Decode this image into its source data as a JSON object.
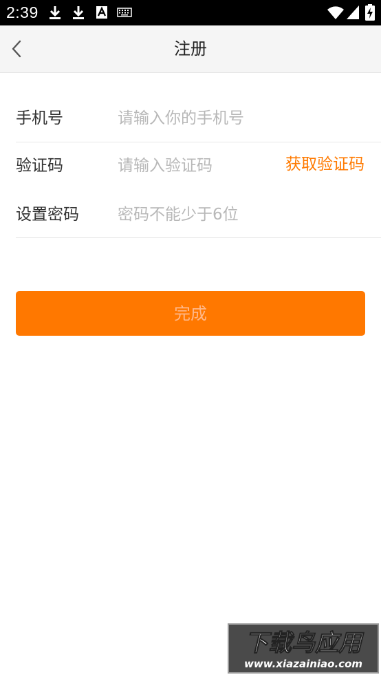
{
  "status_bar": {
    "time": "2:39",
    "icons": [
      "download-icon",
      "download-icon",
      "font-icon",
      "keyboard-icon",
      "wifi-icon",
      "signal-icon",
      "battery-icon"
    ]
  },
  "app_bar": {
    "title": "注册",
    "back_icon": "chevron-left-icon"
  },
  "form": {
    "phone": {
      "label": "手机号",
      "placeholder": "请输入你的手机号",
      "value": ""
    },
    "code": {
      "label": "验证码",
      "placeholder": "请输入验证码",
      "value": "",
      "action_label": "获取验证码"
    },
    "password": {
      "label": "设置密码",
      "placeholder": "密码不能少于6位",
      "value": ""
    }
  },
  "submit": {
    "label": "完成"
  },
  "watermark": {
    "brand": "下载鸟应用",
    "url": "www.xiazainiao.com"
  },
  "colors": {
    "accent": "#ff7800",
    "action_text": "#ff7a00",
    "status_bar": "#000000",
    "app_bar": "#f5f5f5"
  }
}
